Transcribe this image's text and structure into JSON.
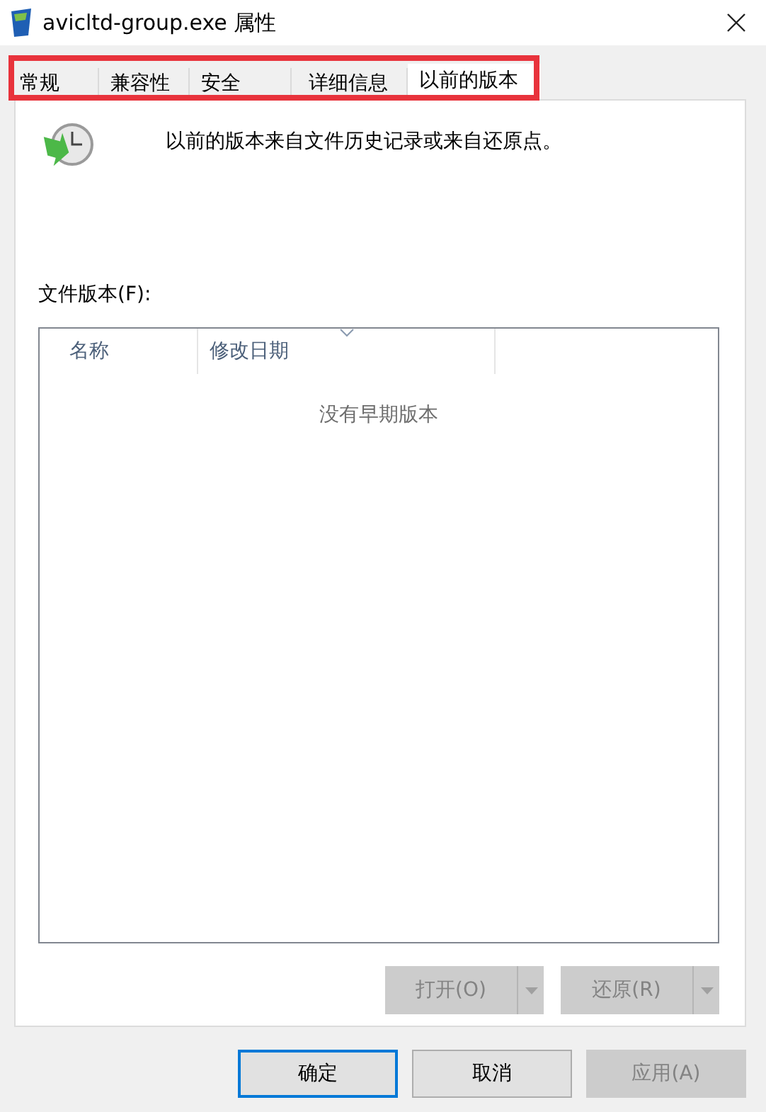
{
  "window": {
    "title": "avicltd-group.exe 属性"
  },
  "tabs": [
    {
      "label": "常规",
      "selected": false
    },
    {
      "label": "兼容性",
      "selected": false
    },
    {
      "label": "安全",
      "selected": false
    },
    {
      "label": "详细信息",
      "selected": false
    },
    {
      "label": "以前的版本",
      "selected": true
    }
  ],
  "description": "以前的版本来自文件历史记录或来自还原点。",
  "file_versions": {
    "label": "文件版本(F):",
    "columns": [
      "名称",
      "修改日期"
    ],
    "empty_message": "没有早期版本"
  },
  "actions": [
    {
      "label": "打开(O)",
      "disabled": true
    },
    {
      "label": "还原(R)",
      "disabled": true
    }
  ],
  "buttons": [
    {
      "label": "确定",
      "default": true,
      "disabled": false
    },
    {
      "label": "取消",
      "default": false,
      "disabled": false
    },
    {
      "label": "应用(A)",
      "default": false,
      "disabled": true
    }
  ]
}
